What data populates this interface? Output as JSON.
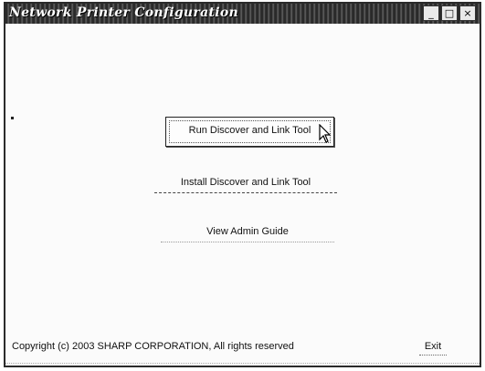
{
  "window": {
    "title": "Network Printer Configuration",
    "controls": {
      "minimize": "_",
      "maximize": "□",
      "close": "×"
    }
  },
  "header": {
    "subtitle": ""
  },
  "actions": {
    "run_tool": "Run Discover and Link Tool",
    "install_tool": "Install Discover and Link Tool",
    "view_admin_guide": "View Admin Guide"
  },
  "footer": {
    "copyright": "Copyright (c) 2003 SHARP CORPORATION, All rights reserved",
    "exit": "Exit"
  },
  "icons": {
    "cursor": "mouse-pointer-icon"
  }
}
